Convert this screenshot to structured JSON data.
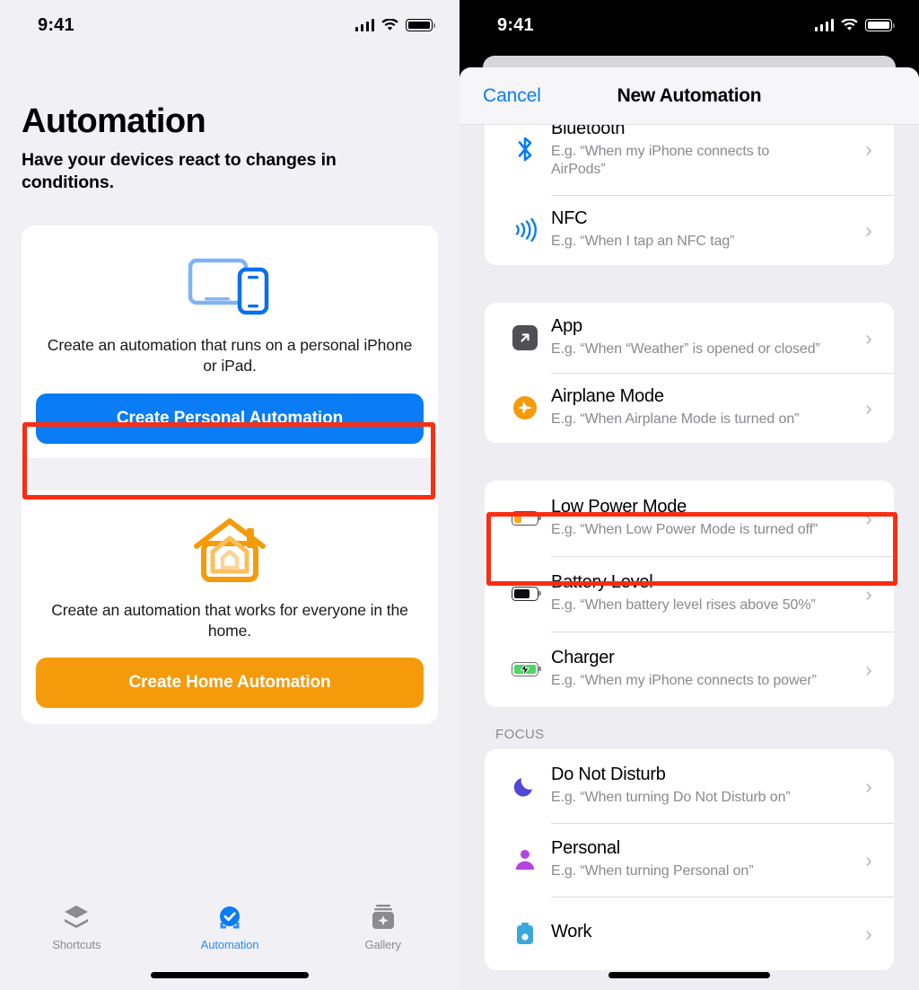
{
  "left": {
    "status_bar": {
      "time": "9:41",
      "signal_icon": "cellular-signal-icon",
      "wifi_icon": "wifi-icon",
      "battery_icon": "battery-icon"
    },
    "page_title": "Automation",
    "page_subtitle": "Have your devices react to changes in conditions.",
    "personal_card": {
      "illustration_icon": "devices-ipad-iphone-icon",
      "description": "Create an automation that runs on a personal iPhone or iPad.",
      "button_label": "Create Personal Automation",
      "button_color": "#0a7cf5",
      "highlighted": true
    },
    "home_card": {
      "illustration_icon": "home-house-icon",
      "description": "Create an automation that works for everyone in the home.",
      "button_label": "Create Home Automation",
      "button_color": "#f59b0b",
      "highlighted": false
    },
    "tabs": [
      {
        "label": "Shortcuts",
        "icon": "shortcuts-stack-icon",
        "active": false
      },
      {
        "label": "Automation",
        "icon": "automation-check-icon",
        "active": true
      },
      {
        "label": "Gallery",
        "icon": "gallery-sparkle-icon",
        "active": false
      }
    ],
    "accent_color": "#2c8cf0"
  },
  "right": {
    "status_bar": {
      "time": "9:41",
      "signal_icon": "cellular-signal-icon",
      "wifi_icon": "wifi-icon",
      "battery_icon": "battery-icon"
    },
    "nav": {
      "cancel_label": "Cancel",
      "title": "New Automation"
    },
    "groups": [
      {
        "section_label": "",
        "rows": [
          {
            "title": "Bluetooth",
            "subtitle": "E.g. “When my iPhone connects to AirPods”",
            "icon": "bluetooth-icon",
            "highlighted": false
          },
          {
            "title": "NFC",
            "subtitle": "E.g. “When I tap an NFC tag”",
            "icon": "nfc-waves-icon",
            "highlighted": false
          }
        ]
      },
      {
        "section_label": "",
        "rows": [
          {
            "title": "App",
            "subtitle": "E.g. “When “Weather” is opened or closed”",
            "icon": "app-arrow-icon",
            "highlighted": false
          },
          {
            "title": "Airplane Mode",
            "subtitle": "E.g. “When Airplane Mode is turned on”",
            "icon": "airplane-mode-icon",
            "highlighted": false
          }
        ]
      },
      {
        "section_label": "",
        "rows": [
          {
            "title": "Low Power Mode",
            "subtitle": "E.g. “When Low Power Mode is turned off”",
            "icon": "low-power-battery-icon",
            "highlighted": true
          },
          {
            "title": "Battery Level",
            "subtitle": "E.g. “When battery level rises above 50%”",
            "icon": "battery-level-icon",
            "highlighted": false
          },
          {
            "title": "Charger",
            "subtitle": "E.g. “When my iPhone connects to power”",
            "icon": "charger-battery-icon",
            "highlighted": false
          }
        ]
      },
      {
        "section_label": "FOCUS",
        "rows": [
          {
            "title": "Do Not Disturb",
            "subtitle": "E.g. “When turning Do Not Disturb on”",
            "icon": "moon-icon",
            "highlighted": false
          },
          {
            "title": "Personal",
            "subtitle": "E.g. “When turning Personal on”",
            "icon": "person-icon",
            "highlighted": false
          },
          {
            "title": "Work",
            "subtitle": "",
            "icon": "work-briefcase-icon",
            "highlighted": false
          }
        ]
      }
    ],
    "chevron_glyph": "›",
    "accent_color": "#0a7cf5"
  },
  "annotations": {
    "highlight_color": "#fa2d12",
    "boxes": [
      {
        "target": "create-personal-automation-button"
      },
      {
        "target": "low-power-mode-row"
      }
    ]
  }
}
